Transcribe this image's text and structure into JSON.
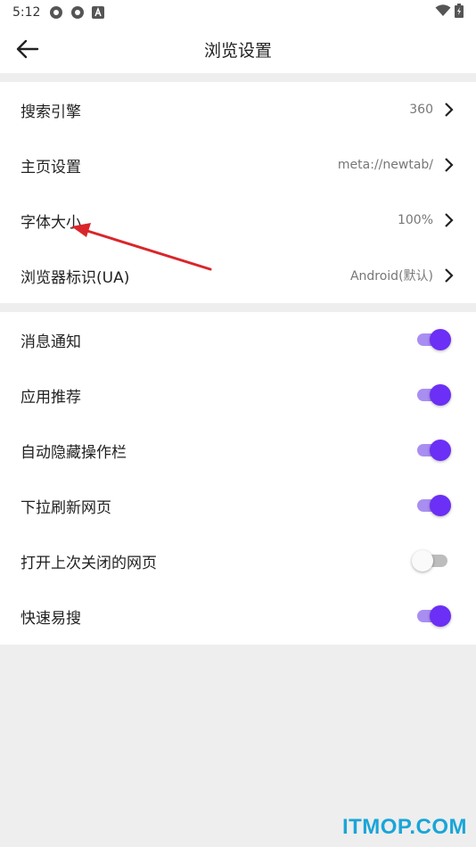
{
  "status_bar": {
    "time": "5:12"
  },
  "app_bar": {
    "title": "浏览设置"
  },
  "section1": {
    "items": [
      {
        "label": "搜索引擎",
        "value": "360"
      },
      {
        "label": "主页设置",
        "value": "meta://newtab/"
      },
      {
        "label": "字体大小",
        "value": "100%"
      },
      {
        "label": "浏览器标识(UA)",
        "value": "Android(默认)"
      }
    ]
  },
  "section2": {
    "items": [
      {
        "label": "消息通知",
        "on": true
      },
      {
        "label": "应用推荐",
        "on": true
      },
      {
        "label": "自动隐藏操作栏",
        "on": true
      },
      {
        "label": "下拉刷新网页",
        "on": true
      },
      {
        "label": "打开上次关闭的网页",
        "on": false
      },
      {
        "label": "快速易搜",
        "on": true
      }
    ]
  },
  "watermark": "ITMOP.COM",
  "colors": {
    "accent": "#6b2ff5",
    "accent_track": "#a98ef2",
    "annotation_arrow": "#d9262b",
    "watermark": "#1aa5d8"
  }
}
